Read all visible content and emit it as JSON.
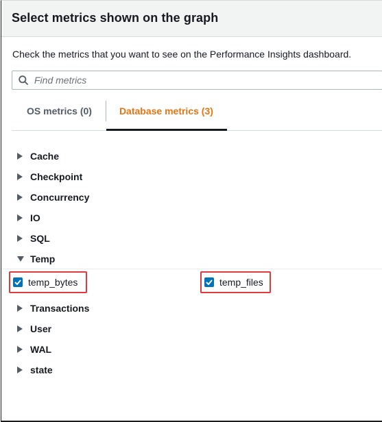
{
  "modal": {
    "title": "Select metrics shown on the graph",
    "description": "Check the metrics that you want to see on the Performance Insights dashboard."
  },
  "search": {
    "placeholder": "Find metrics",
    "icon": "search-icon"
  },
  "tabs": [
    {
      "label": "OS metrics (0)",
      "active": false
    },
    {
      "label": "Database metrics (3)",
      "active": true
    }
  ],
  "groups_before": [
    {
      "label": "Cache",
      "expanded": false
    },
    {
      "label": "Checkpoint",
      "expanded": false
    },
    {
      "label": "Concurrency",
      "expanded": false
    },
    {
      "label": "IO",
      "expanded": false
    },
    {
      "label": "SQL",
      "expanded": false
    }
  ],
  "temp_group": {
    "label": "Temp",
    "expanded": true,
    "metrics": [
      {
        "label": "temp_bytes",
        "checked": true
      },
      {
        "label": "temp_files",
        "checked": true
      }
    ]
  },
  "groups_after": [
    {
      "label": "Transactions",
      "expanded": false
    },
    {
      "label": "User",
      "expanded": false
    },
    {
      "label": "WAL",
      "expanded": false
    },
    {
      "label": "state",
      "expanded": false
    }
  ],
  "colors": {
    "active_tab": "#ec7211",
    "checkbox": "#0073bb",
    "highlight": "#e0393e"
  }
}
